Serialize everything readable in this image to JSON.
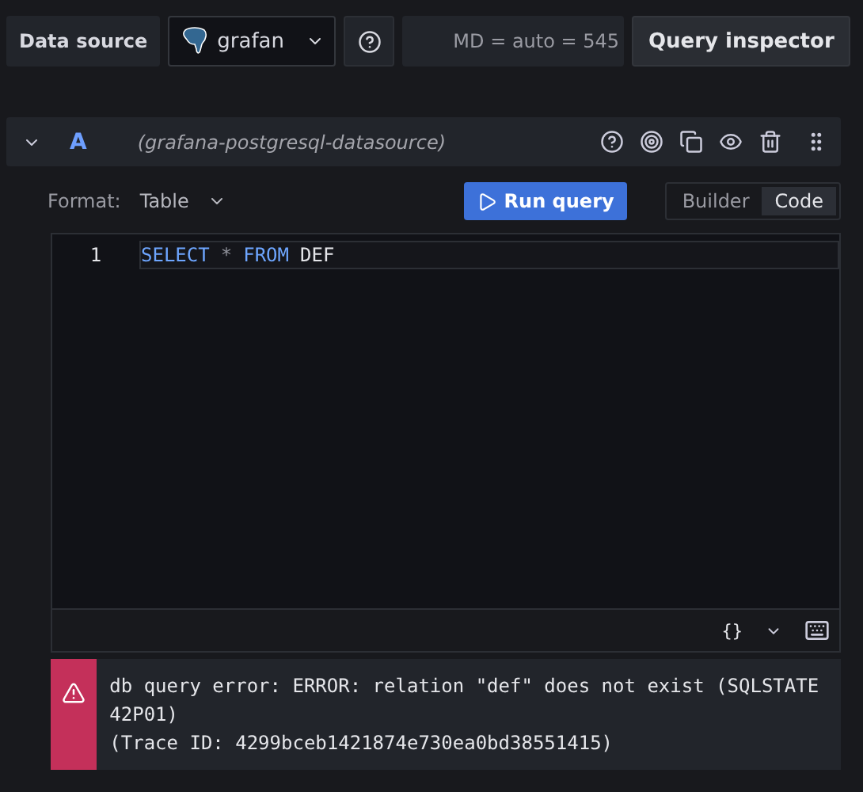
{
  "toolbar": {
    "label": "Data source",
    "datasource": "grafan",
    "options_text": "MD = auto = 545",
    "inspector_button": "Query inspector"
  },
  "query": {
    "ref_id": "A",
    "datasource_name": "(grafana-postgresql-datasource)",
    "expanded": true
  },
  "format": {
    "label": "Format:",
    "value": "Table"
  },
  "run_button": "Run query",
  "modes": [
    {
      "label": "Builder",
      "selected": false
    },
    {
      "label": "Code",
      "selected": true
    }
  ],
  "editor": {
    "lines": [
      {
        "number": "1",
        "tokens": [
          {
            "text": "SELECT",
            "kind": "keyword"
          },
          {
            "text": "*",
            "kind": "operator"
          },
          {
            "text": "FROM",
            "kind": "keyword"
          },
          {
            "text": "DEF",
            "kind": "identifier"
          }
        ]
      }
    ],
    "format_button": "{}"
  },
  "error": {
    "lines": [
      "db query error: ERROR: relation \"def\" does not exist (SQLSTATE 42P01)",
      "(Trace ID: 4299bceb1421874e730ea0bd38551415)"
    ]
  }
}
